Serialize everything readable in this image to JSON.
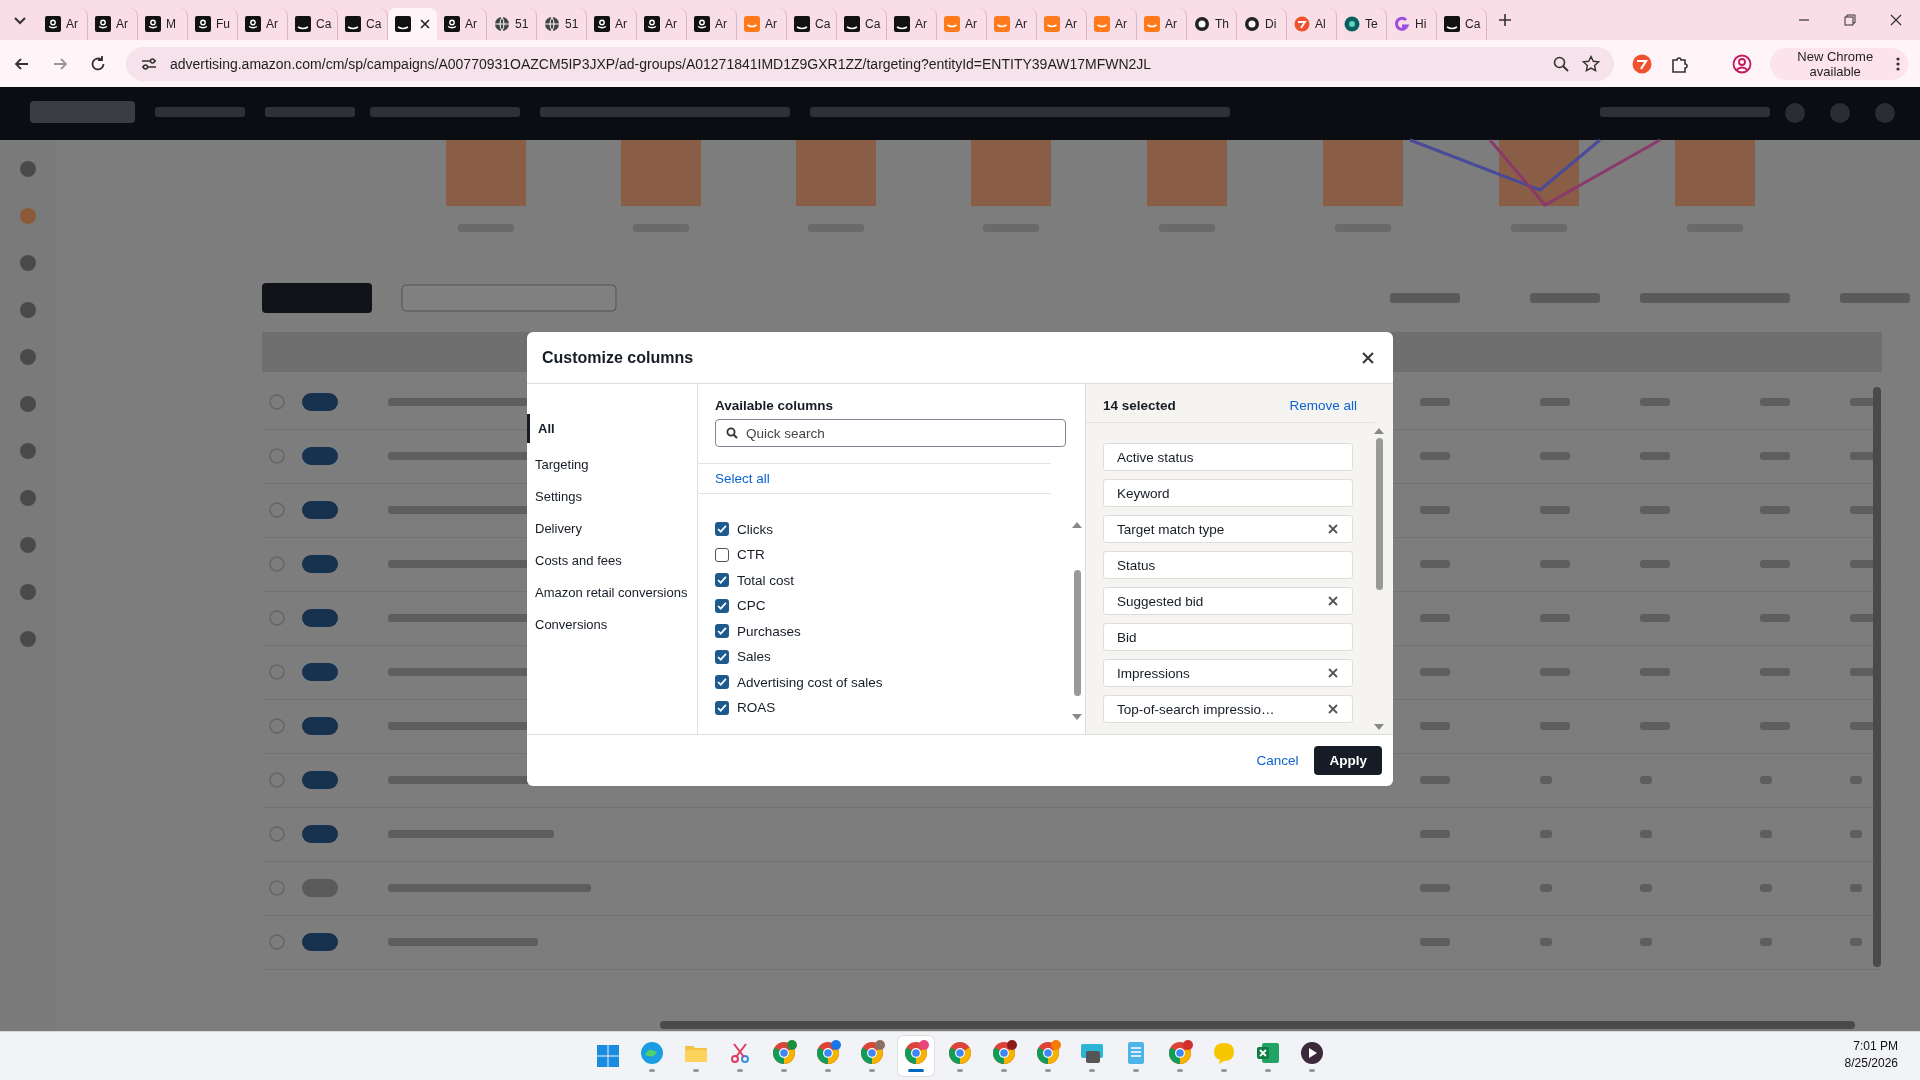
{
  "browser": {
    "tabs": [
      {
        "title": "Ar",
        "kind": "amazon",
        "selected": false
      },
      {
        "title": "Ar",
        "kind": "amazon",
        "selected": false
      },
      {
        "title": "M",
        "kind": "amazon",
        "selected": false
      },
      {
        "title": "Fu",
        "kind": "amazon",
        "selected": false
      },
      {
        "title": "Ar",
        "kind": "amazon",
        "selected": false
      },
      {
        "title": "Ca",
        "kind": "box",
        "selected": false
      },
      {
        "title": "Ca",
        "kind": "box",
        "selected": false
      },
      {
        "kind": "box",
        "selected": true
      },
      {
        "title": "Ar",
        "kind": "amazon",
        "selected": false
      },
      {
        "title": "51",
        "kind": "globe",
        "selected": false
      },
      {
        "title": "51",
        "kind": "globe",
        "selected": false
      },
      {
        "title": "Ar",
        "kind": "amazon",
        "selected": false
      },
      {
        "title": "Ar",
        "kind": "amazon",
        "selected": false
      },
      {
        "title": "Ar",
        "kind": "amazon",
        "selected": false
      },
      {
        "title": "Ar",
        "kind": "orange",
        "selected": false
      },
      {
        "title": "Ca",
        "kind": "box",
        "selected": false
      },
      {
        "title": "Ca",
        "kind": "box",
        "selected": false
      },
      {
        "title": "Ar",
        "kind": "box",
        "selected": false
      },
      {
        "title": "Ar",
        "kind": "orange",
        "selected": false
      },
      {
        "title": "Ar",
        "kind": "orange",
        "selected": false
      },
      {
        "title": "Ar",
        "kind": "orange",
        "selected": false
      },
      {
        "title": "Ar",
        "kind": "orange",
        "selected": false
      },
      {
        "title": "Ar",
        "kind": "orange",
        "selected": false
      },
      {
        "title": "Th",
        "kind": "ring",
        "selected": false
      },
      {
        "title": "Di",
        "kind": "ring",
        "selected": false
      },
      {
        "title": "Al",
        "kind": "swirl",
        "selected": false
      },
      {
        "title": "Te",
        "kind": "teal",
        "selected": false
      },
      {
        "title": "Hi",
        "kind": "purple",
        "selected": false
      },
      {
        "title": "Ca",
        "kind": "box",
        "selected": false
      }
    ],
    "url": "advertising.amazon.com/cm/sp/campaigns/A00770931OAZCM5IP3JXP/ad-groups/A01271841IMD1Z9GXR1ZZ/targeting?entityId=ENTITY39AW17MFWN2JL",
    "update_button": "New Chrome available"
  },
  "dialog": {
    "title": "Customize columns",
    "categories": [
      {
        "label": "All",
        "selected": true
      },
      {
        "label": "Targeting",
        "selected": false
      },
      {
        "label": "Settings",
        "selected": false
      },
      {
        "label": "Delivery",
        "selected": false
      },
      {
        "label": "Costs and fees",
        "selected": false
      },
      {
        "label": "Amazon retail conversions",
        "selected": false
      },
      {
        "label": "Conversions",
        "selected": false
      }
    ],
    "available_heading": "Available columns",
    "search": {
      "placeholder": "Quick search"
    },
    "select_all": "Select all",
    "columns": [
      {
        "label": "Clicks",
        "checked": true
      },
      {
        "label": "CTR",
        "checked": false
      },
      {
        "label": "Total cost",
        "checked": true
      },
      {
        "label": "CPC",
        "checked": true
      },
      {
        "label": "Purchases",
        "checked": true
      },
      {
        "label": "Sales",
        "checked": true
      },
      {
        "label": "Advertising cost of sales",
        "checked": true
      },
      {
        "label": "ROAS",
        "checked": true
      }
    ],
    "selected_count": "14 selected",
    "remove_all": "Remove all",
    "selected_columns": [
      {
        "label": "Active status",
        "removable": false
      },
      {
        "label": "Keyword",
        "removable": false
      },
      {
        "label": "Target match type",
        "removable": true
      },
      {
        "label": "Status",
        "removable": false
      },
      {
        "label": "Suggested bid",
        "removable": true
      },
      {
        "label": "Bid",
        "removable": false
      },
      {
        "label": "Impressions",
        "removable": true
      },
      {
        "label": "Top-of-search impressio…",
        "removable": true
      }
    ],
    "cancel": "Cancel",
    "apply": "Apply"
  },
  "taskbar": {
    "apps": [
      {
        "kind": "windows",
        "active": false
      },
      {
        "kind": "edge",
        "active": false
      },
      {
        "kind": "folder",
        "active": false
      },
      {
        "kind": "snip",
        "active": false
      },
      {
        "kind": "chrome",
        "color": "#1e8e3e",
        "active": false
      },
      {
        "kind": "chrome",
        "color": "#1a73e8",
        "active": false
      },
      {
        "kind": "chrome",
        "color": "#8d6e63",
        "active": false
      },
      {
        "kind": "chrome",
        "color": "#e8457a",
        "active": true
      },
      {
        "kind": "chrome",
        "active": false
      },
      {
        "kind": "chrome",
        "color": "#8b1a1a",
        "active": false
      },
      {
        "kind": "chrome",
        "color": "#f57c00",
        "active": false
      },
      {
        "kind": "keyboard",
        "active": false
      },
      {
        "kind": "notepad",
        "active": false
      },
      {
        "kind": "chrome",
        "color": "#d32f2f",
        "active": false
      },
      {
        "kind": "chat",
        "active": false
      },
      {
        "kind": "excel",
        "active": false
      },
      {
        "kind": "player",
        "active": false
      }
    ],
    "time": "7:01 PM",
    "date": "8/25/2026"
  }
}
